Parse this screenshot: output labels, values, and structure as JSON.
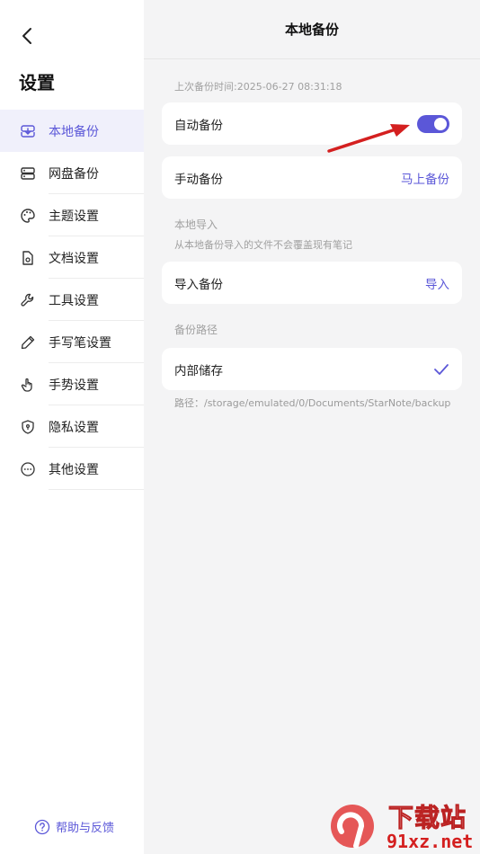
{
  "sidebar": {
    "title": "设置",
    "items": [
      {
        "label": "本地备份",
        "icon": "local-backup-icon",
        "active": true
      },
      {
        "label": "网盘备份",
        "icon": "cloud-drive-icon",
        "active": false
      },
      {
        "label": "主题设置",
        "icon": "palette-icon",
        "active": false
      },
      {
        "label": "文档设置",
        "icon": "document-gear-icon",
        "active": false
      },
      {
        "label": "工具设置",
        "icon": "wrench-icon",
        "active": false
      },
      {
        "label": "手写笔设置",
        "icon": "pen-icon",
        "active": false
      },
      {
        "label": "手势设置",
        "icon": "hand-gesture-icon",
        "active": false
      },
      {
        "label": "隐私设置",
        "icon": "shield-icon",
        "active": false
      },
      {
        "label": "其他设置",
        "icon": "more-icon",
        "active": false
      }
    ],
    "help_label": "帮助与反馈"
  },
  "main": {
    "title": "本地备份",
    "last_backup": "上次备份时间:2025-06-27 08:31:18",
    "auto_backup": {
      "label": "自动备份",
      "enabled": true
    },
    "manual_backup": {
      "label": "手动备份",
      "action": "马上备份"
    },
    "import_section": {
      "title": "本地导入",
      "note": "从本地备份导入的文件不会覆盖现有笔记"
    },
    "import_backup": {
      "label": "导入备份",
      "action": "导入"
    },
    "path_section": {
      "title": "备份路径"
    },
    "internal_storage": {
      "label": "内部储存",
      "selected": true
    },
    "path": "路径：/storage/emulated/0/Documents/StarNote/backup"
  },
  "watermark": {
    "top": "下载站",
    "bottom": "91xz.net"
  },
  "colors": {
    "accent": "#5b57d8",
    "arrow": "#d42020",
    "background": "#f4f4f5"
  }
}
